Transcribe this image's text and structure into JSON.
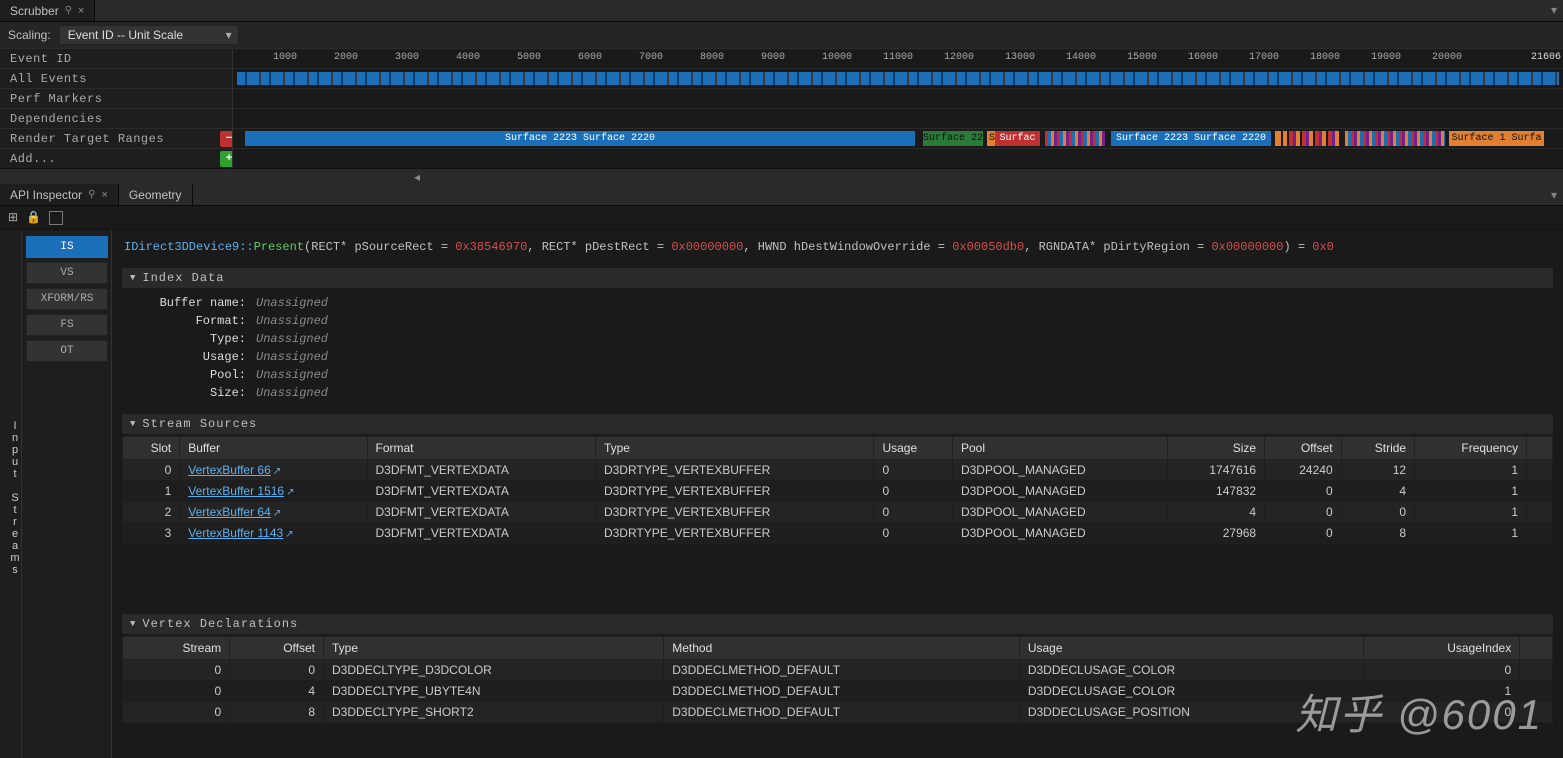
{
  "watermark": "知乎 @6001",
  "scrubber": {
    "tab": "Scrubber",
    "scalingLabel": "Scaling:",
    "scalingValue": "Event ID -- Unit Scale",
    "rows": {
      "eventId": "Event ID",
      "allEvents": "All Events",
      "perfMarkers": "Perf Markers",
      "dependencies": "Dependencies",
      "rtr": "Render Target Ranges",
      "add": "Add..."
    },
    "ticks": [
      "1000",
      "2000",
      "3000",
      "4000",
      "5000",
      "6000",
      "7000",
      "8000",
      "9000",
      "10000",
      "11000",
      "12000",
      "13000",
      "14000",
      "15000",
      "16000",
      "17000",
      "18000",
      "19000",
      "20000"
    ],
    "tickEnd": "21606",
    "rtrBars": {
      "b1": "Surface 2223 Surface 2220",
      "b2": "Surface 22",
      "b3pre": "S",
      "b3": "Surfac",
      "b4": "Surface 2223 Surface 2220",
      "b5": "Surface 1 Surfa"
    }
  },
  "inspector": {
    "tabAPI": "API Inspector",
    "tabGeom": "Geometry",
    "vertLabel": "Input Streams",
    "stages": [
      "IS",
      "VS",
      "XFORM/RS",
      "FS",
      "OT"
    ],
    "activeStage": 0,
    "api": {
      "class": "IDirect3DDevice9",
      "sep": "::",
      "method": "Present",
      "p1": "RECT* pSourceRect = ",
      "v1": "0x38546970",
      "p2": ",  RECT* pDestRect = ",
      "v2": "0x00000000",
      "p3": ",  HWND hDestWindowOverride = ",
      "v3": "0x00050db0",
      "p4": ",  RGNDATA* pDirtyRegion = ",
      "v4": "0x00000000",
      "p5": ") = ",
      "v5": "0x0"
    },
    "indexData": {
      "title": "Index Data",
      "rows": [
        {
          "k": "Buffer name",
          "v": "Unassigned"
        },
        {
          "k": "Format",
          "v": "Unassigned"
        },
        {
          "k": "Type",
          "v": "Unassigned"
        },
        {
          "k": "Usage",
          "v": "Unassigned"
        },
        {
          "k": "Pool",
          "v": "Unassigned"
        },
        {
          "k": "Size",
          "v": "Unassigned"
        }
      ]
    },
    "streamSources": {
      "title": "Stream Sources",
      "headers": [
        "Slot",
        "Buffer",
        "Format",
        "Type",
        "Usage",
        "Pool",
        "Size",
        "Offset",
        "Stride",
        "Frequency"
      ],
      "rows": [
        {
          "slot": 0,
          "buf": "VertexBuffer 66",
          "fmt": "D3DFMT_VERTEXDATA",
          "type": "D3DRTYPE_VERTEXBUFFER",
          "usage": "0",
          "pool": "D3DPOOL_MANAGED",
          "size": 1747616,
          "offset": 24240,
          "stride": 12,
          "freq": 1
        },
        {
          "slot": 1,
          "buf": "VertexBuffer 1516",
          "fmt": "D3DFMT_VERTEXDATA",
          "type": "D3DRTYPE_VERTEXBUFFER",
          "usage": "0",
          "pool": "D3DPOOL_MANAGED",
          "size": 147832,
          "offset": 0,
          "stride": 4,
          "freq": 1
        },
        {
          "slot": 2,
          "buf": "VertexBuffer 64",
          "fmt": "D3DFMT_VERTEXDATA",
          "type": "D3DRTYPE_VERTEXBUFFER",
          "usage": "0",
          "pool": "D3DPOOL_MANAGED",
          "size": 4,
          "offset": 0,
          "stride": 0,
          "freq": 1
        },
        {
          "slot": 3,
          "buf": "VertexBuffer 1143",
          "fmt": "D3DFMT_VERTEXDATA",
          "type": "D3DRTYPE_VERTEXBUFFER",
          "usage": "0",
          "pool": "D3DPOOL_MANAGED",
          "size": 27968,
          "offset": 0,
          "stride": 8,
          "freq": 1
        }
      ]
    },
    "vertexDecl": {
      "title": "Vertex Declarations",
      "headers": [
        "Stream",
        "Offset",
        "Type",
        "Method",
        "Usage",
        "UsageIndex"
      ],
      "rows": [
        {
          "stream": 0,
          "offset": 0,
          "type": "D3DDECLTYPE_D3DCOLOR",
          "method": "D3DDECLMETHOD_DEFAULT",
          "usage": "D3DDECLUSAGE_COLOR",
          "ui": 0
        },
        {
          "stream": 0,
          "offset": 4,
          "type": "D3DDECLTYPE_UBYTE4N",
          "method": "D3DDECLMETHOD_DEFAULT",
          "usage": "D3DDECLUSAGE_COLOR",
          "ui": 1
        },
        {
          "stream": 0,
          "offset": 8,
          "type": "D3DDECLTYPE_SHORT2",
          "method": "D3DDECLMETHOD_DEFAULT",
          "usage": "D3DDECLUSAGE_POSITION",
          "ui": 0
        }
      ]
    }
  }
}
